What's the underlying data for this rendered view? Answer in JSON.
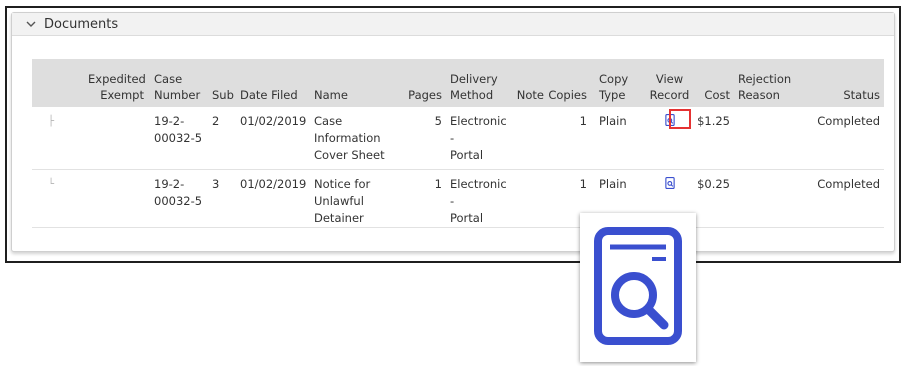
{
  "panel": {
    "title": "Documents",
    "collapse_icon": "chevron-down-icon"
  },
  "columns": {
    "expedited": [
      "Expedited",
      "Exempt"
    ],
    "case_number": [
      "Case",
      "Number"
    ],
    "sub": "Sub",
    "date_filed": "Date Filed",
    "name": "Name",
    "pages": "Pages",
    "delivery": [
      "Delivery",
      "Method"
    ],
    "note": "Note",
    "copies": "Copies",
    "copy_type": [
      "Copy",
      "Type"
    ],
    "view_record": [
      "View",
      "Record"
    ],
    "cost": "Cost",
    "rejection": [
      "Rejection",
      "Reason"
    ],
    "status": "Status"
  },
  "rows": [
    {
      "tree": "├",
      "expedited": "",
      "case_number": [
        "19-2-",
        "00032-5"
      ],
      "sub": "2",
      "date_filed": "01/02/2019",
      "name": [
        "Case",
        "Information",
        "Cover Sheet"
      ],
      "pages": "5",
      "delivery": [
        "Electronic -",
        "Portal"
      ],
      "note": "",
      "copies": "1",
      "copy_type": "Plain",
      "view_icon": "view-record-icon",
      "cost": "$1.25",
      "rejection": "",
      "status": "Completed"
    },
    {
      "tree": "└",
      "expedited": "",
      "case_number": [
        "19-2-",
        "00032-5"
      ],
      "sub": "3",
      "date_filed": "01/02/2019",
      "name": [
        "Notice for",
        "Unlawful",
        "Detainer"
      ],
      "pages": "1",
      "delivery": [
        "Electronic -",
        "Portal"
      ],
      "note": "",
      "copies": "1",
      "copy_type": "Plain",
      "view_icon": "view-record-icon",
      "cost": "$0.25",
      "rejection": "",
      "status": "Completed"
    }
  ],
  "colors": {
    "icon": "#3a4fcf",
    "highlight": "#e53232",
    "header_bg": "#dedede"
  }
}
